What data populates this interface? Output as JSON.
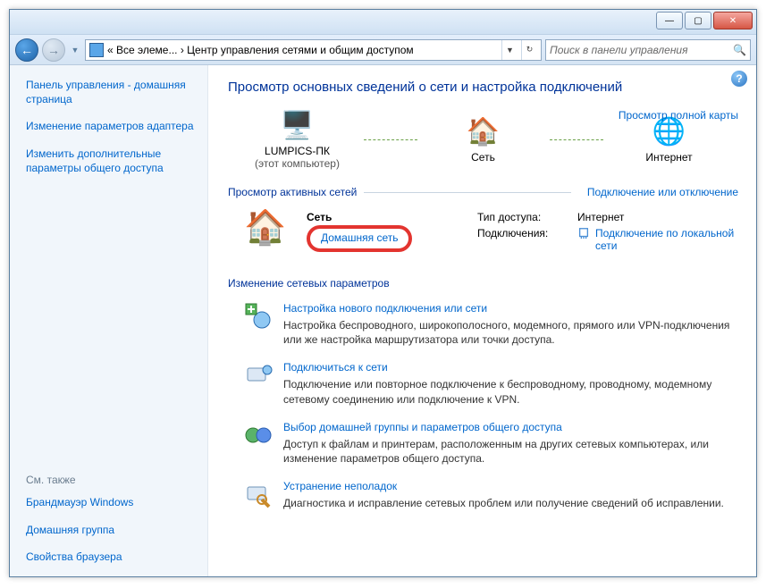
{
  "titlebar": {
    "min": "—",
    "max": "▢",
    "close": "✕"
  },
  "address": {
    "crumb1": "« Все элеме...",
    "sep": "›",
    "crumb2": "Центр управления сетями и общим доступом"
  },
  "search_placeholder": "Поиск в панели управления",
  "sidebar": {
    "items": [
      "Панель управления - домашняя страница",
      "Изменение параметров адаптера",
      "Изменить дополнительные параметры общего доступа"
    ],
    "seealso_title": "См. также",
    "seealso": [
      "Брандмауэр Windows",
      "Домашняя группа",
      "Свойства браузера"
    ]
  },
  "page": {
    "title": "Просмотр основных сведений о сети и настройка подключений",
    "full_map_link": "Просмотр полной карты",
    "map": {
      "node1": {
        "label": "LUMPICS-ПК",
        "sublabel": "(этот компьютер)"
      },
      "node2": {
        "label": "Сеть"
      },
      "node3": {
        "label": "Интернет"
      }
    },
    "active_section": "Просмотр активных сетей",
    "active_section_link": "Подключение или отключение",
    "network": {
      "name": "Сеть",
      "type_link": "Домашняя сеть",
      "access_k": "Тип доступа:",
      "access_v": "Интернет",
      "conn_k": "Подключения:",
      "conn_v": "Подключение по локальной сети"
    },
    "change_heading": "Изменение сетевых параметров",
    "options": [
      {
        "title": "Настройка нового подключения или сети",
        "desc": "Настройка беспроводного, широкополосного, модемного, прямого или VPN-подключения или же настройка маршрутизатора или точки доступа."
      },
      {
        "title": "Подключиться к сети",
        "desc": "Подключение или повторное подключение к беспроводному, проводному, модемному сетевому соединению или подключение к VPN."
      },
      {
        "title": "Выбор домашней группы и параметров общего доступа",
        "desc": "Доступ к файлам и принтерам, расположенным на других сетевых компьютерах, или изменение параметров общего доступа."
      },
      {
        "title": "Устранение неполадок",
        "desc": "Диагностика и исправление сетевых проблем или получение сведений об исправлении."
      }
    ]
  }
}
